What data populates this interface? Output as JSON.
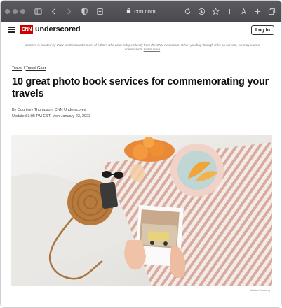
{
  "browser": {
    "url": "cnn.com",
    "icons": [
      "sidebar-icon",
      "back-icon",
      "forward-icon",
      "shield-icon",
      "reader-icon",
      "lock-icon",
      "reload-icon",
      "download-icon",
      "bookmark-star-icon",
      "text-size-icon",
      "font-icon",
      "new-tab-icon",
      "tabs-icon"
    ]
  },
  "site": {
    "logo_text": "CNN",
    "brand": "underscored",
    "login_label": "Log In"
  },
  "disclaimer": {
    "text": "Content is created by CNN Underscored's team of editors who work independently from the CNN newsroom. When you buy through links on our site, we may earn a commission.",
    "link": "Learn more"
  },
  "breadcrumb": {
    "first": "Travel",
    "separator": "/",
    "second": "Travel Gear"
  },
  "article": {
    "title": "10 great photo book services for commemorating your travels",
    "byline": "By Courtney Thompson, CNN Underscored",
    "updated": "Updated 3:05 PM EST, Mon January 23, 2023"
  },
  "image": {
    "credit": "Artifact Uprising"
  },
  "colors": {
    "cnn_red": "#cc0000",
    "toolbar": "#4f4f54"
  }
}
